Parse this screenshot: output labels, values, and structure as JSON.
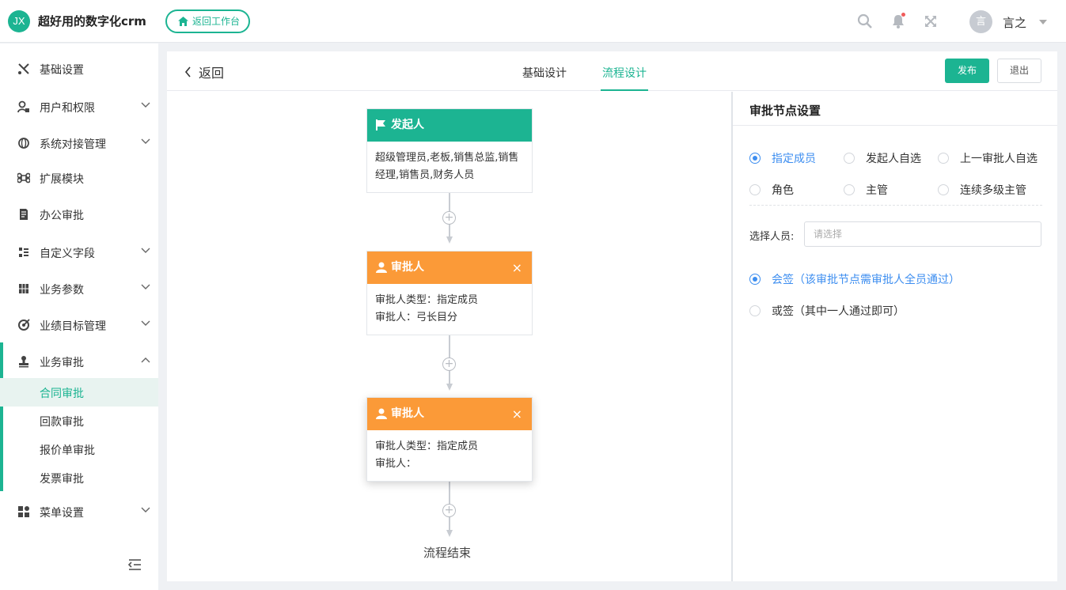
{
  "header": {
    "logo_text": "JX",
    "app_title": "超好用的数字化crm",
    "back_workspace": "返回工作台",
    "user_avatar_text": "言",
    "user_name": "言之"
  },
  "sidebar": {
    "items": [
      {
        "label": "基础设置",
        "icon": "wrench-icon"
      },
      {
        "label": "用户和权限",
        "icon": "user-lock-icon"
      },
      {
        "label": "系统对接管理",
        "icon": "globe-icon"
      },
      {
        "label": "扩展模块",
        "icon": "command-icon"
      },
      {
        "label": "办公审批",
        "icon": "document-icon"
      },
      {
        "label": "自定义字段",
        "icon": "list-icon"
      },
      {
        "label": "业务参数",
        "icon": "grid-icon"
      },
      {
        "label": "业绩目标管理",
        "icon": "target-icon"
      },
      {
        "label": "业务审批",
        "icon": "stamp-icon"
      },
      {
        "label": "菜单设置",
        "icon": "apps-icon"
      }
    ],
    "sub_items": [
      "合同审批",
      "回款审批",
      "报价单审批",
      "发票审批"
    ]
  },
  "topbar": {
    "back_label": "返回",
    "tabs": [
      "基础设计",
      "流程设计"
    ],
    "active_tab": "流程设计",
    "publish_label": "发布",
    "exit_label": "退出"
  },
  "flow": {
    "start_node": {
      "title": "发起人",
      "body": "超级管理员,老板,销售总监,销售经理,销售员,财务人员"
    },
    "approver_nodes": [
      {
        "title": "审批人",
        "type_line": "审批人类型：指定成员",
        "approver_line": "审批人：弓长目分"
      },
      {
        "title": "审批人",
        "type_line": "审批人类型：指定成员",
        "approver_line": "审批人："
      }
    ],
    "close_glyph": "×",
    "plus_glyph": "+",
    "end_label": "流程结束"
  },
  "settings": {
    "title": "审批节点设置",
    "approver_types": [
      "指定成员",
      "发起人自选",
      "上一审批人自选",
      "角色",
      "主管",
      "连续多级主管"
    ],
    "approver_type_selected": "指定成员",
    "select_label": "选择人员:",
    "select_placeholder": "请选择",
    "sign_modes": [
      "会签（该审批节点需审批人全员通过）",
      "或签（其中一人通过即可）"
    ],
    "sign_mode_selected": "会签（该审批节点需审批人全员通过）"
  },
  "colors": {
    "brand": "#1cb492",
    "approver_header": "#fb9a38",
    "radio_checked": "#3d8ef0"
  }
}
